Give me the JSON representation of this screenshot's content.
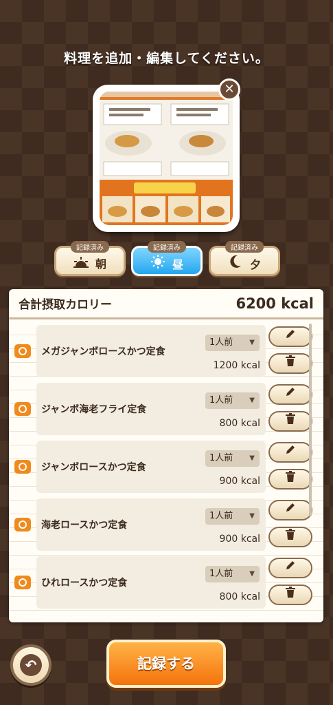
{
  "header": {
    "title": "料理を追加・編集してください。"
  },
  "photo": {
    "close_icon": "close-icon"
  },
  "meal_tabs": [
    {
      "badge": "記録済み",
      "label": "朝",
      "icon": "sunrise-icon",
      "active": false
    },
    {
      "badge": "記録済み",
      "label": "昼",
      "icon": "sun-icon",
      "active": true
    },
    {
      "badge": "記録済み",
      "label": "夕",
      "icon": "moon-icon",
      "active": false
    }
  ],
  "summary": {
    "label": "合計摂取カロリー",
    "value": "6200 kcal"
  },
  "items": [
    {
      "name": "メガジャンボロースかつ定食",
      "portion": "1人前",
      "kcal": "1200 kcal"
    },
    {
      "name": "ジャンボ海老フライ定食",
      "portion": "1人前",
      "kcal": "800 kcal"
    },
    {
      "name": "ジャンボロースかつ定食",
      "portion": "1人前",
      "kcal": "900 kcal"
    },
    {
      "name": "海老ロースかつ定食",
      "portion": "1人前",
      "kcal": "900 kcal"
    },
    {
      "name": "ひれロースかつ定食",
      "portion": "1人前",
      "kcal": "800 kcal"
    }
  ],
  "footer": {
    "record_label": "記録する",
    "back_icon": "back-arrow-icon"
  },
  "colors": {
    "accent": "#f4730c",
    "active_tab": "#25a6ef",
    "brown": "#6b4a35"
  }
}
